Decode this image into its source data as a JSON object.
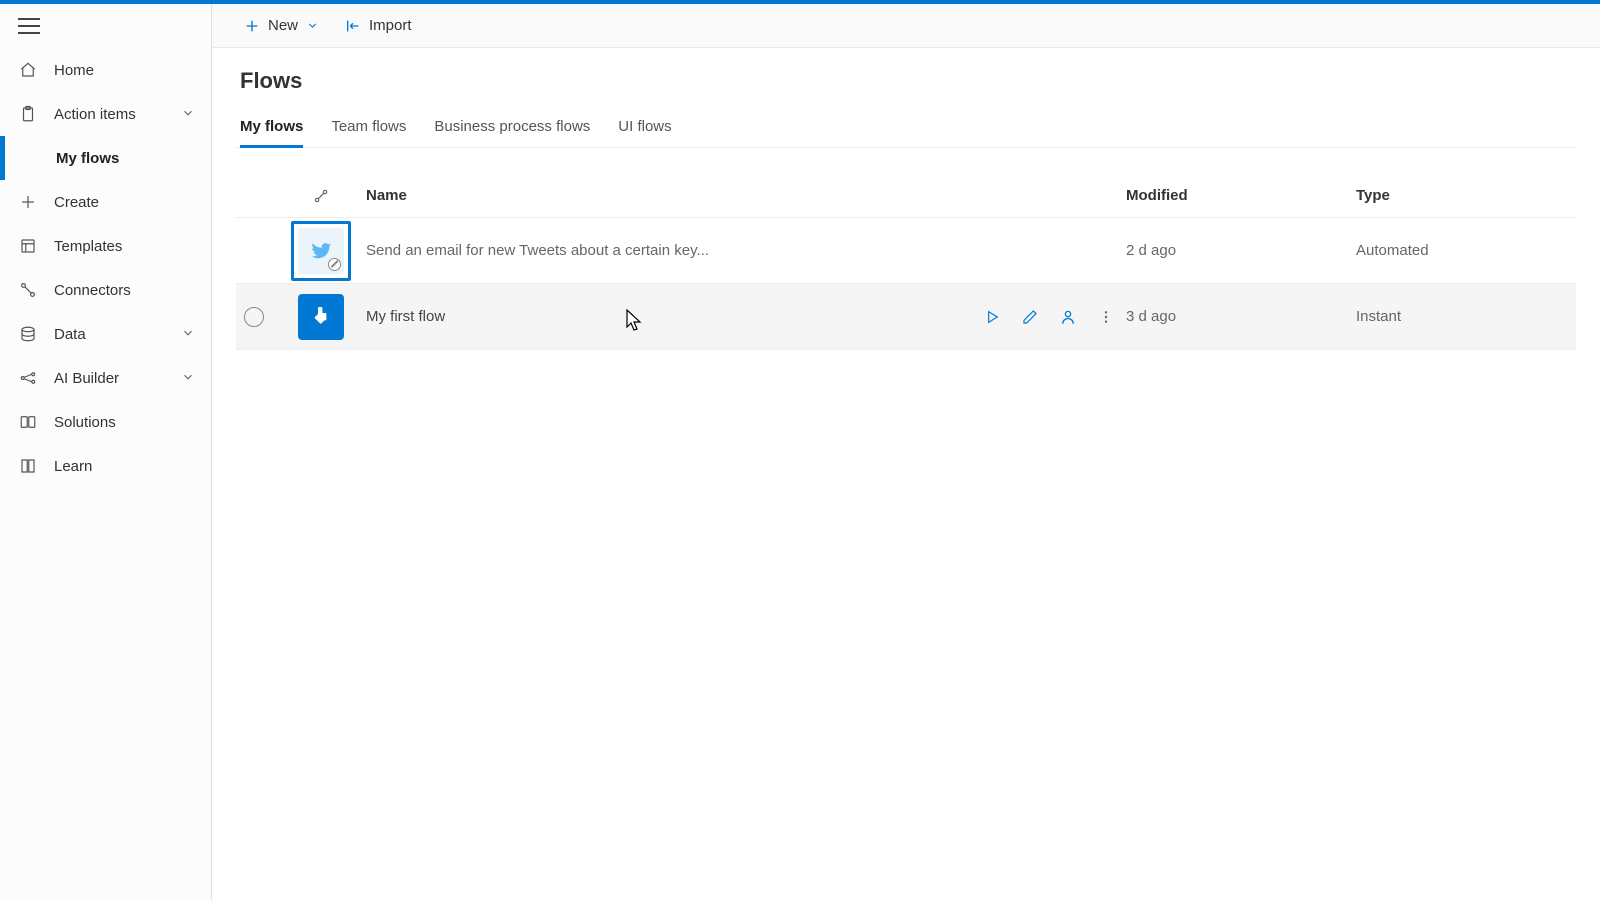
{
  "colors": {
    "brand": "#0078d4"
  },
  "sidebar": {
    "items": [
      {
        "label": "Home"
      },
      {
        "label": "Action items"
      },
      {
        "label": "My flows"
      },
      {
        "label": "Create"
      },
      {
        "label": "Templates"
      },
      {
        "label": "Connectors"
      },
      {
        "label": "Data"
      },
      {
        "label": "AI Builder"
      },
      {
        "label": "Solutions"
      },
      {
        "label": "Learn"
      }
    ]
  },
  "toolbar": {
    "new_label": "New",
    "import_label": "Import"
  },
  "page": {
    "title": "Flows",
    "tabs": [
      {
        "label": "My flows"
      },
      {
        "label": "Team flows"
      },
      {
        "label": "Business process flows"
      },
      {
        "label": "UI flows"
      }
    ]
  },
  "table": {
    "headers": {
      "name": "Name",
      "modified": "Modified",
      "type": "Type"
    },
    "rows": [
      {
        "name": "Send an email for new Tweets about a certain key...",
        "modified": "2 d ago",
        "type": "Automated"
      },
      {
        "name": "My first flow",
        "modified": "3 d ago",
        "type": "Instant"
      }
    ]
  }
}
